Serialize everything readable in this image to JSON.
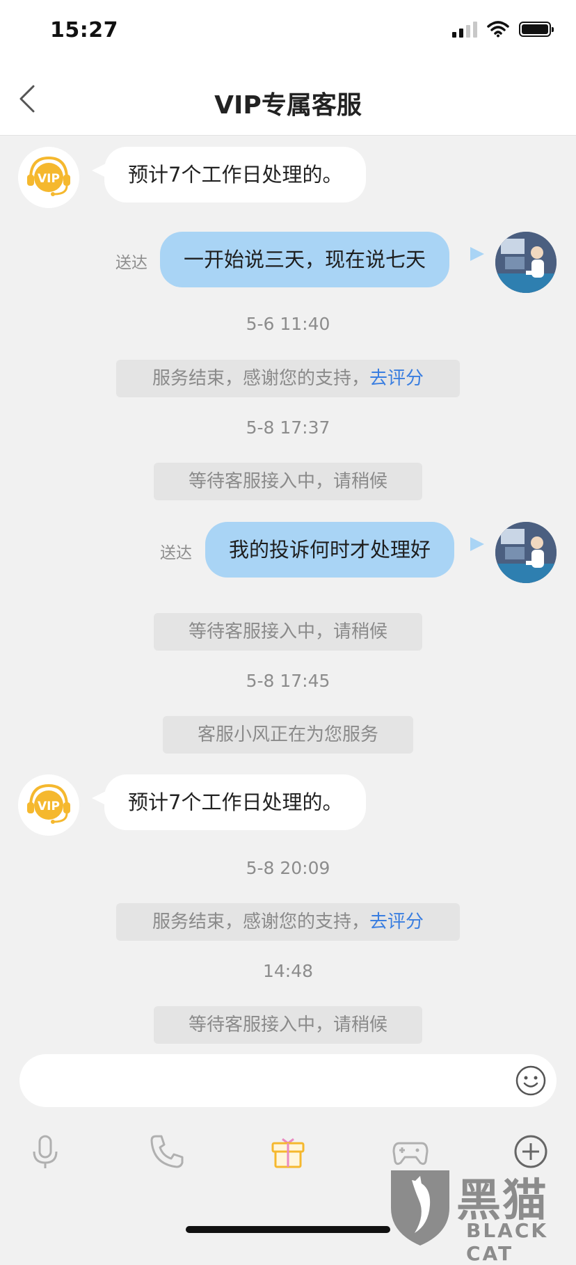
{
  "status_bar": {
    "time": "15:27"
  },
  "header": {
    "title": "VIP专属客服"
  },
  "messages": [
    {
      "type": "incoming",
      "text": "预计7个工作日处理的。",
      "avatar": "vip-headset-icon"
    },
    {
      "type": "outgoing",
      "text": "一开始说三天，现在说七天",
      "status": "送达"
    },
    {
      "type": "timestamp",
      "text": "5-6 11:40"
    },
    {
      "type": "system",
      "text": "服务结束，感谢您的支持，",
      "link": "去评分"
    },
    {
      "type": "timestamp",
      "text": "5-8 17:37"
    },
    {
      "type": "system",
      "text": "等待客服接入中，请稍候"
    },
    {
      "type": "outgoing",
      "text": "我的投诉何时才处理好",
      "status": "送达"
    },
    {
      "type": "system",
      "text": "等待客服接入中，请稍候"
    },
    {
      "type": "timestamp",
      "text": "5-8 17:45"
    },
    {
      "type": "system",
      "text": "客服小风正在为您服务"
    },
    {
      "type": "incoming",
      "text": "预计7个工作日处理的。",
      "avatar": "vip-headset-icon"
    },
    {
      "type": "timestamp",
      "text": "5-8 20:09"
    },
    {
      "type": "system",
      "text": "服务结束，感谢您的支持，",
      "link": "去评分"
    },
    {
      "type": "timestamp",
      "text": "14:48"
    },
    {
      "type": "system",
      "text": "等待客服接入中，请稍候"
    }
  ],
  "composer": {
    "placeholder": ""
  },
  "toolbar": [
    "microphone-icon",
    "phone-icon",
    "gift-icon",
    "gamepad-icon",
    "plus-circle-icon"
  ],
  "colors": {
    "accent_gold": "#f5b82e",
    "bubble_out": "#a9d4f5",
    "link": "#3a7ee0",
    "background": "#f1f1f1"
  },
  "watermark": {
    "title": "黑猫",
    "subtitle": "BLACK CAT"
  }
}
